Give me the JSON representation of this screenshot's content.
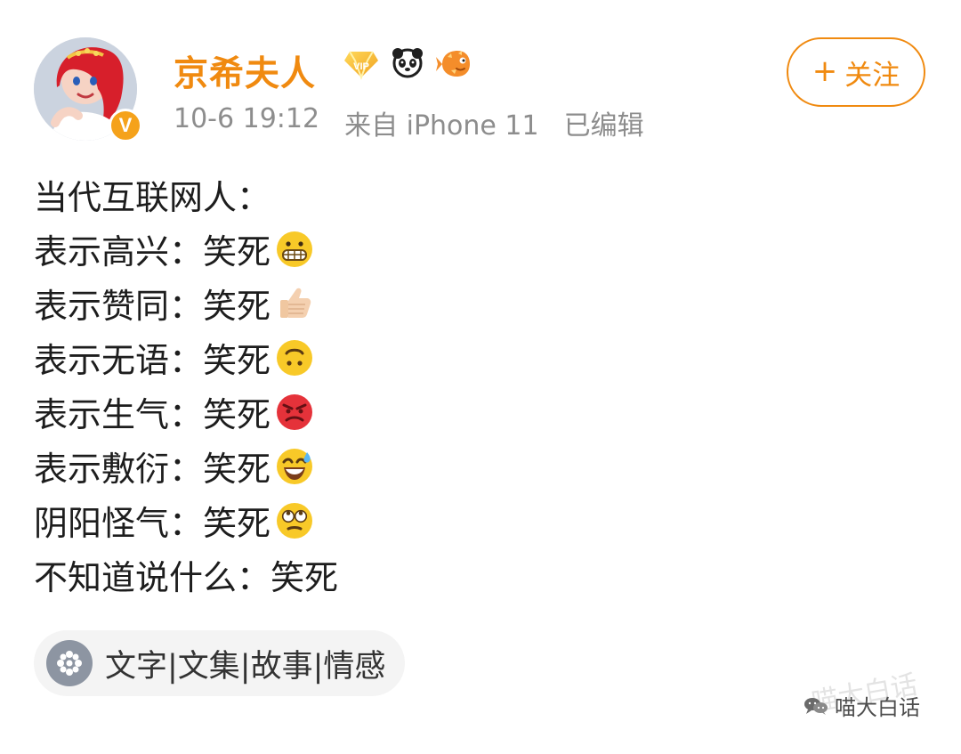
{
  "header": {
    "user_name": "京希夫人",
    "avatar_badge": "V",
    "meta": {
      "time": "10-6 19:12",
      "source": "来自 iPhone 11",
      "edited": "已编辑"
    },
    "follow_button": {
      "plus": "+",
      "label": "关注"
    },
    "badges": {
      "vip_text": "VIP"
    }
  },
  "post": {
    "lines": [
      {
        "text": "当代互联网人：",
        "emoji": ""
      },
      {
        "text": "表示高兴：笑死",
        "emoji": "grinning-face-icon"
      },
      {
        "text": "表示赞同：笑死",
        "emoji": "thumbs-up-icon"
      },
      {
        "text": "表示无语：笑死",
        "emoji": "upside-down-face-icon"
      },
      {
        "text": "表示生气：笑死",
        "emoji": "angry-face-icon"
      },
      {
        "text": "表示敷衍：笑死",
        "emoji": "sweat-smile-icon"
      },
      {
        "text": "阴阳怪气：笑死",
        "emoji": "eye-roll-face-icon"
      },
      {
        "text": "不知道说什么：笑死",
        "emoji": ""
      }
    ]
  },
  "topic": {
    "label": "文字|文集|故事|情感"
  },
  "watermark": {
    "text": "喵大白话"
  },
  "colors": {
    "brand_orange": "#f08a10",
    "meta_gray": "#8d8d8d",
    "topic_bg": "#f4f4f4"
  }
}
